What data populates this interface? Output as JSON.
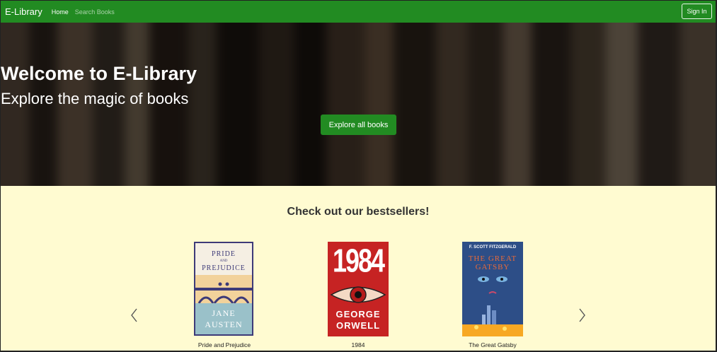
{
  "navbar": {
    "brand": "E-Library",
    "links": [
      {
        "label": "Home"
      },
      {
        "label": "Search Books"
      }
    ],
    "signin_label": "Sign In"
  },
  "hero": {
    "title": "Welcome to E-Library",
    "subtitle": "Explore the magic of books",
    "button_label": "Explore all books"
  },
  "bestsellers": {
    "title": "Check out our bestsellers!",
    "books": [
      {
        "title": "Pride and Prejudice",
        "cover_line1": "PRIDE",
        "cover_line2": "AND",
        "cover_line3": "PREJUDICE",
        "cover_author1": "JANE",
        "cover_author2": "AUSTEN"
      },
      {
        "title": "1984",
        "cover_number": "1984",
        "cover_author1": "GEORGE",
        "cover_author2": "ORWELL"
      },
      {
        "title": "The Great Gatsby",
        "cover_author": "F. SCOTT FITZGERALD",
        "cover_line1": "THE GREAT",
        "cover_line2": "GATSBY"
      }
    ]
  },
  "colors": {
    "primary": "#228b22",
    "section_bg": "#fffbd1"
  }
}
